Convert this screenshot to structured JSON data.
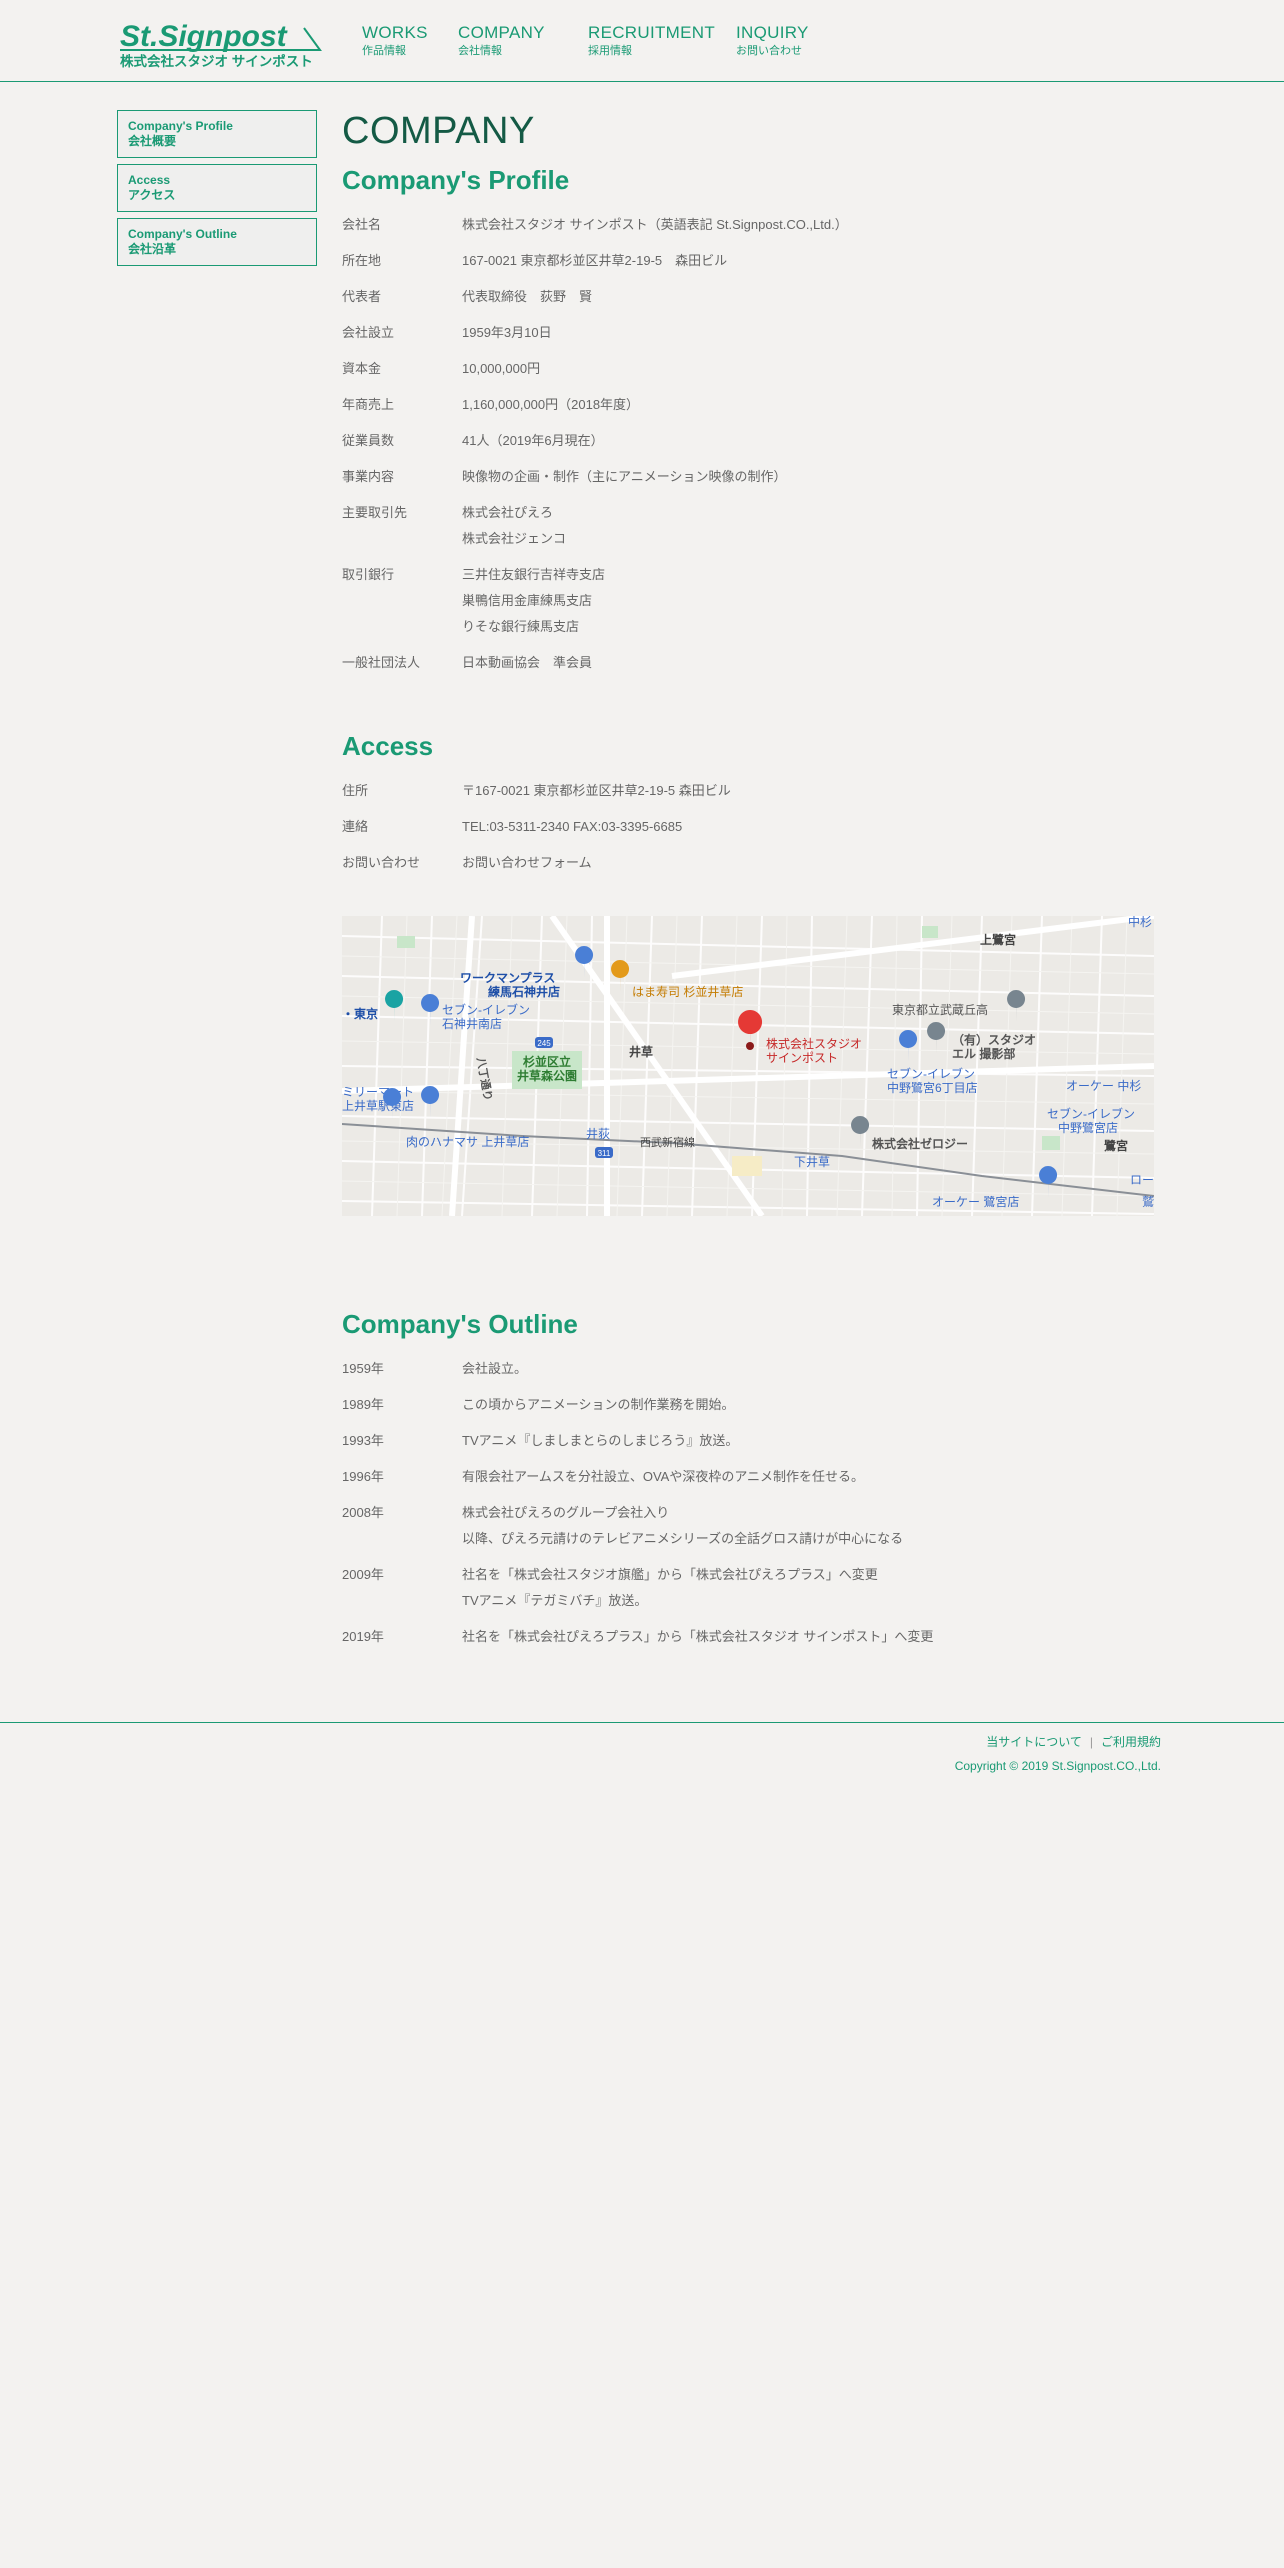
{
  "header": {
    "logo": {
      "text_en": "St.Signpost",
      "text_jp": "株式会社スタジオ サインポスト"
    },
    "nav": [
      {
        "en": "WORKS",
        "jp": "作品情報"
      },
      {
        "en": "COMPANY",
        "jp": "会社情報"
      },
      {
        "en": "RECRUITMENT",
        "jp": "採用情報"
      },
      {
        "en": "INQUIRY",
        "jp": "お問い合わせ"
      }
    ]
  },
  "sidebar": [
    {
      "en": "Company's Profile",
      "jp": "会社概要"
    },
    {
      "en": "Access",
      "jp": "アクセス"
    },
    {
      "en": "Company's Outline",
      "jp": "会社沿革"
    }
  ],
  "main": {
    "page_title": "COMPANY",
    "profile": {
      "title": "Company's Profile",
      "rows": [
        {
          "k": "会社名",
          "v": [
            "株式会社スタジオ サインポスト（英語表記 St.Signpost.CO.,Ltd.）"
          ]
        },
        {
          "k": "所在地",
          "v": [
            "167-0021 東京都杉並区井草2-19-5　森田ビル"
          ]
        },
        {
          "k": "代表者",
          "v": [
            "代表取締役　荻野　賢"
          ]
        },
        {
          "k": "会社設立",
          "v": [
            "1959年3月10日"
          ]
        },
        {
          "k": "資本金",
          "v": [
            "10,000,000円"
          ]
        },
        {
          "k": "年商売上",
          "v": [
            "1,160,000,000円（2018年度）"
          ]
        },
        {
          "k": "従業員数",
          "v": [
            "41人（2019年6月現在）"
          ]
        },
        {
          "k": "事業内容",
          "v": [
            "映像物の企画・制作（主にアニメーション映像の制作）"
          ]
        },
        {
          "k": "主要取引先",
          "v": [
            "株式会社ぴえろ",
            "株式会社ジェンコ"
          ]
        },
        {
          "k": "取引銀行",
          "v": [
            "三井住友銀行吉祥寺支店",
            "巣鴨信用金庫練馬支店",
            "りそな銀行練馬支店"
          ]
        },
        {
          "k": "一般社団法人",
          "v": [
            "日本動画協会　準会員"
          ]
        }
      ]
    },
    "access": {
      "title": "Access",
      "rows": [
        {
          "k": "住所",
          "v": [
            "〒167-0021 東京都杉並区井草2-19-5 森田ビル"
          ]
        },
        {
          "k": "連絡",
          "v": [
            "TEL:03-5311-2340 FAX:03-3395-6685"
          ]
        },
        {
          "k": "お問い合わせ",
          "v": [
            "お問い合わせフォーム"
          ]
        }
      ],
      "map": {
        "labels": {
          "kamisaginomiya": "上鷺宮",
          "workman1": "ワークマンプラス",
          "workman2": "練馬石神井店",
          "hamazushi": "はま寿司 杉並井草店",
          "tokyo": "・東京",
          "seven1a": "セブン-イレブン",
          "seven1b": "石神井南店",
          "park1": "杉並区立",
          "park2": "井草森公園",
          "igusa": "井草",
          "hachi": "八丁通り",
          "studio1": "株式会社スタジオ",
          "studio2": "サインポスト",
          "school": "東京都立武蔵丘高",
          "el1": "（有）スタジオ",
          "el2": "エル 撮影部",
          "seven2a": "セブン-イレブン",
          "seven2b": "中野鷺宮6丁目店",
          "okay1": "オーケー 中杉",
          "family1": "ミリーマート",
          "family2": "上井草駅東店",
          "hamamasa": "肉のハナマサ 上井草店",
          "ogikubo": "井荻",
          "seibu": "西武新宿線",
          "shimoiguse": "下井草",
          "zerology": "株式会社ゼロジー",
          "seven3a": "セブン-イレブン",
          "seven3b": "中野鷺宮店",
          "saginomiya": "鷺宮",
          "okay2": "オーケー 鷺宮店",
          "r245": "245",
          "r311": "311",
          "ro": "ロー",
          "naka": "中杉",
          "washi": "鷲"
        }
      }
    },
    "outline": {
      "title": "Company's Outline",
      "rows": [
        {
          "k": "1959年",
          "v": [
            "会社設立。"
          ]
        },
        {
          "k": "1989年",
          "v": [
            "この頃からアニメーションの制作業務を開始。"
          ]
        },
        {
          "k": "1993年",
          "v": [
            "TVアニメ『しましまとらのしまじろう』放送。"
          ]
        },
        {
          "k": "1996年",
          "v": [
            "有限会社アームスを分社設立、OVAや深夜枠のアニメ制作を任せる。"
          ]
        },
        {
          "k": "2008年",
          "v": [
            "株式会社ぴえろのグループ会社入り",
            "以降、ぴえろ元請けのテレビアニメシリーズの全話グロス請けが中心になる"
          ]
        },
        {
          "k": "2009年",
          "v": [
            "社名を「株式会社スタジオ旗艦」から「株式会社ぴえろプラス」へ変更",
            "TVアニメ『テガミバチ』放送。"
          ]
        },
        {
          "k": "2019年",
          "v": [
            "社名を「株式会社ぴえろプラス」から「株式会社スタジオ サインポスト」へ変更"
          ]
        }
      ]
    }
  },
  "footer": {
    "link_about": "当サイトについて",
    "separator": "|",
    "link_terms": "ご利用規約",
    "copyright": "Copyright © 2019 St.Signpost.CO.,Ltd."
  },
  "colors": {
    "accent": "#1a9a74",
    "title": "#145a45",
    "background": "#f3f2f0"
  }
}
